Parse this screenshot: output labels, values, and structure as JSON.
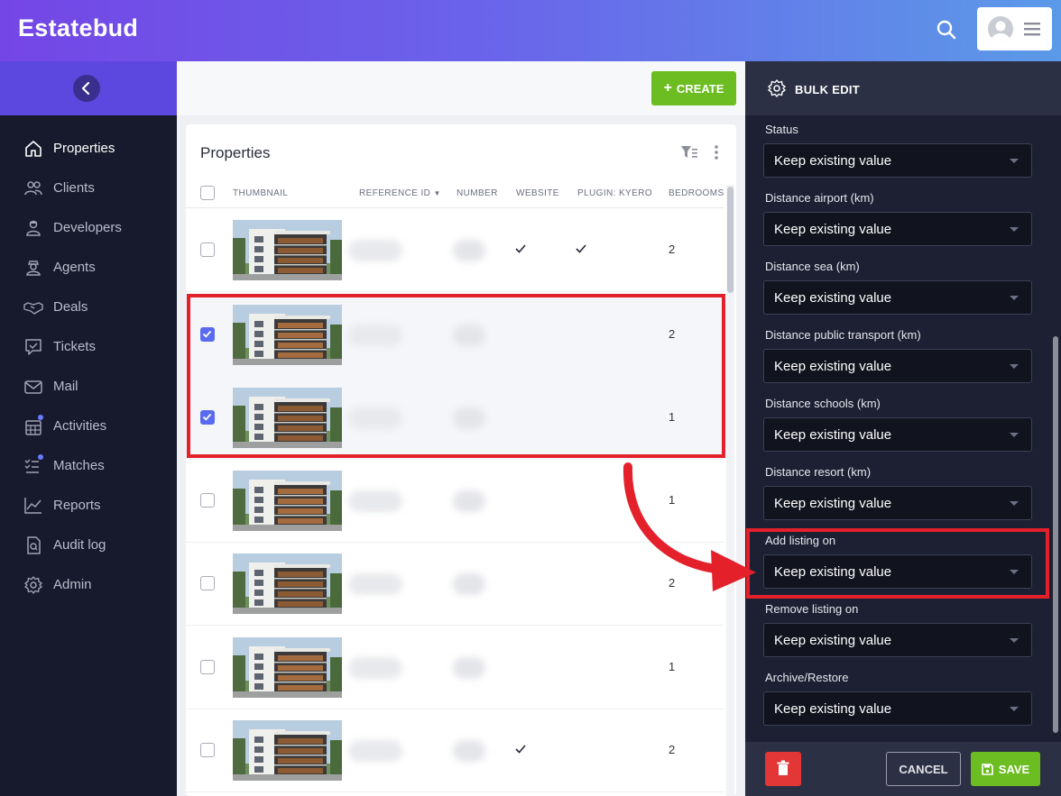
{
  "app": {
    "logo": "Estatebud"
  },
  "sidebar": {
    "items": [
      {
        "label": "Properties",
        "icon": "home-icon",
        "active": true
      },
      {
        "label": "Clients",
        "icon": "users-icon"
      },
      {
        "label": "Developers",
        "icon": "developer-icon"
      },
      {
        "label": "Agents",
        "icon": "agent-icon"
      },
      {
        "label": "Deals",
        "icon": "handshake-icon"
      },
      {
        "label": "Tickets",
        "icon": "ticket-icon"
      },
      {
        "label": "Mail",
        "icon": "mail-icon"
      },
      {
        "label": "Activities",
        "icon": "calendar-icon"
      },
      {
        "label": "Matches",
        "icon": "matches-icon"
      },
      {
        "label": "Reports",
        "icon": "chart-icon"
      },
      {
        "label": "Audit log",
        "icon": "audit-icon"
      },
      {
        "label": "Admin",
        "icon": "gear-icon"
      }
    ]
  },
  "toolbar": {
    "create_label": "CREATE"
  },
  "properties": {
    "title": "Properties",
    "columns": [
      "THUMBNAIL",
      "REFERENCE ID",
      "NUMBER",
      "WEBSITE",
      "PLUGIN: KYERO",
      "BEDROOMS"
    ],
    "rows": [
      {
        "checked": false,
        "website": true,
        "kyero": true,
        "bedrooms": "2"
      },
      {
        "checked": true,
        "website": false,
        "kyero": false,
        "bedrooms": "2"
      },
      {
        "checked": true,
        "website": false,
        "kyero": false,
        "bedrooms": "1"
      },
      {
        "checked": false,
        "website": false,
        "kyero": false,
        "bedrooms": "1"
      },
      {
        "checked": false,
        "website": false,
        "kyero": false,
        "bedrooms": "2"
      },
      {
        "checked": false,
        "website": false,
        "kyero": false,
        "bedrooms": "1"
      },
      {
        "checked": false,
        "website": true,
        "kyero": false,
        "bedrooms": "2"
      }
    ]
  },
  "bulk_edit": {
    "title": "BULK EDIT",
    "fields": [
      {
        "label": "Status",
        "value": "Keep existing value"
      },
      {
        "label": "Distance airport (km)",
        "value": "Keep existing value"
      },
      {
        "label": "Distance sea (km)",
        "value": "Keep existing value"
      },
      {
        "label": "Distance public transport (km)",
        "value": "Keep existing value"
      },
      {
        "label": "Distance schools (km)",
        "value": "Keep existing value"
      },
      {
        "label": "Distance resort (km)",
        "value": "Keep existing value"
      },
      {
        "label": "Add listing on",
        "value": "Keep existing value"
      },
      {
        "label": "Remove listing on",
        "value": "Keep existing value"
      },
      {
        "label": "Archive/Restore",
        "value": "Keep existing value"
      }
    ],
    "cancel_label": "CANCEL",
    "save_label": "SAVE"
  },
  "colors": {
    "accent_green": "#6cbd21",
    "checkbox_blue": "#5a6bf0",
    "annotation_red": "#e4202a",
    "sidebar_bg": "#171a2c"
  }
}
